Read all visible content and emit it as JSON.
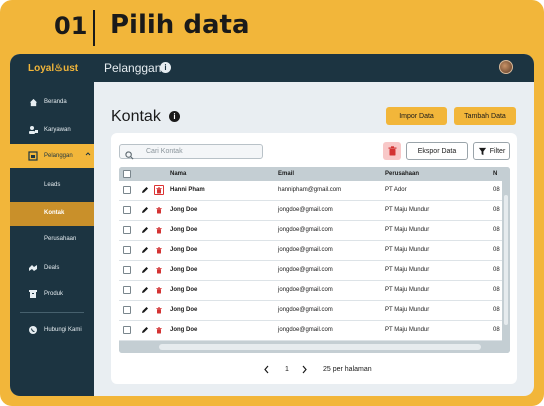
{
  "step": {
    "number": "01",
    "title": "Pilih data"
  },
  "app": {
    "logo": "Loyal♨ust",
    "page_title": "Pelanggan",
    "info_icon": "info-icon",
    "avatar_icon": "avatar"
  },
  "sidebar": {
    "items": [
      {
        "label": "Beranda",
        "icon": "home-icon"
      },
      {
        "label": "Karyawan",
        "icon": "employee-icon"
      },
      {
        "label": "Pelanggan",
        "icon": "customer-icon",
        "expanded": true
      },
      {
        "label": "Deals",
        "icon": "deals-icon"
      },
      {
        "label": "Produk",
        "icon": "product-icon"
      },
      {
        "label": "Hubungi Kami",
        "icon": "whatsapp-icon"
      }
    ],
    "sub_items": [
      {
        "label": "Leads"
      },
      {
        "label": "Kontak",
        "active": true
      },
      {
        "label": "Perusahaan"
      }
    ]
  },
  "main": {
    "title": "Kontak",
    "import_label": "Impor Data",
    "add_label": "Tambah Data"
  },
  "toolbar": {
    "search_placeholder": "Cari Kontak",
    "export_label": "Ekspor Data",
    "filter_label": "Filter"
  },
  "table": {
    "columns": [
      "Nama",
      "Email",
      "Perusahaan",
      "N"
    ],
    "rows": [
      {
        "name": "Hanni Pham",
        "email": "hannipham@gmail.com",
        "company": "PT Ador",
        "extra": "08"
      },
      {
        "name": "Jong Doe",
        "email": "jongdoe@gmail.com",
        "company": "PT Maju Mundur",
        "extra": "08"
      },
      {
        "name": "Jong Doe",
        "email": "jongdoe@gmail.com",
        "company": "PT Maju Mundur",
        "extra": "08"
      },
      {
        "name": "Jong Doe",
        "email": "jongdoe@gmail.com",
        "company": "PT Maju Mundur",
        "extra": "08"
      },
      {
        "name": "Jong Doe",
        "email": "jongdoe@gmail.com",
        "company": "PT Maju Mundur",
        "extra": "08"
      },
      {
        "name": "Jong Doe",
        "email": "jongdoe@gmail.com",
        "company": "PT Maju Mundur",
        "extra": "08"
      },
      {
        "name": "Jong Doe",
        "email": "jongdoe@gmail.com",
        "company": "PT Maju Mundur",
        "extra": "08"
      },
      {
        "name": "Jong Doe",
        "email": "jongdoe@gmail.com",
        "company": "PT Maju Mundur",
        "extra": "08"
      }
    ]
  },
  "pagination": {
    "page": "1",
    "per_page": "25 per halaman"
  },
  "colors": {
    "accent": "#f2b63a",
    "sidebar": "#1c3441",
    "delete": "#d33333"
  }
}
